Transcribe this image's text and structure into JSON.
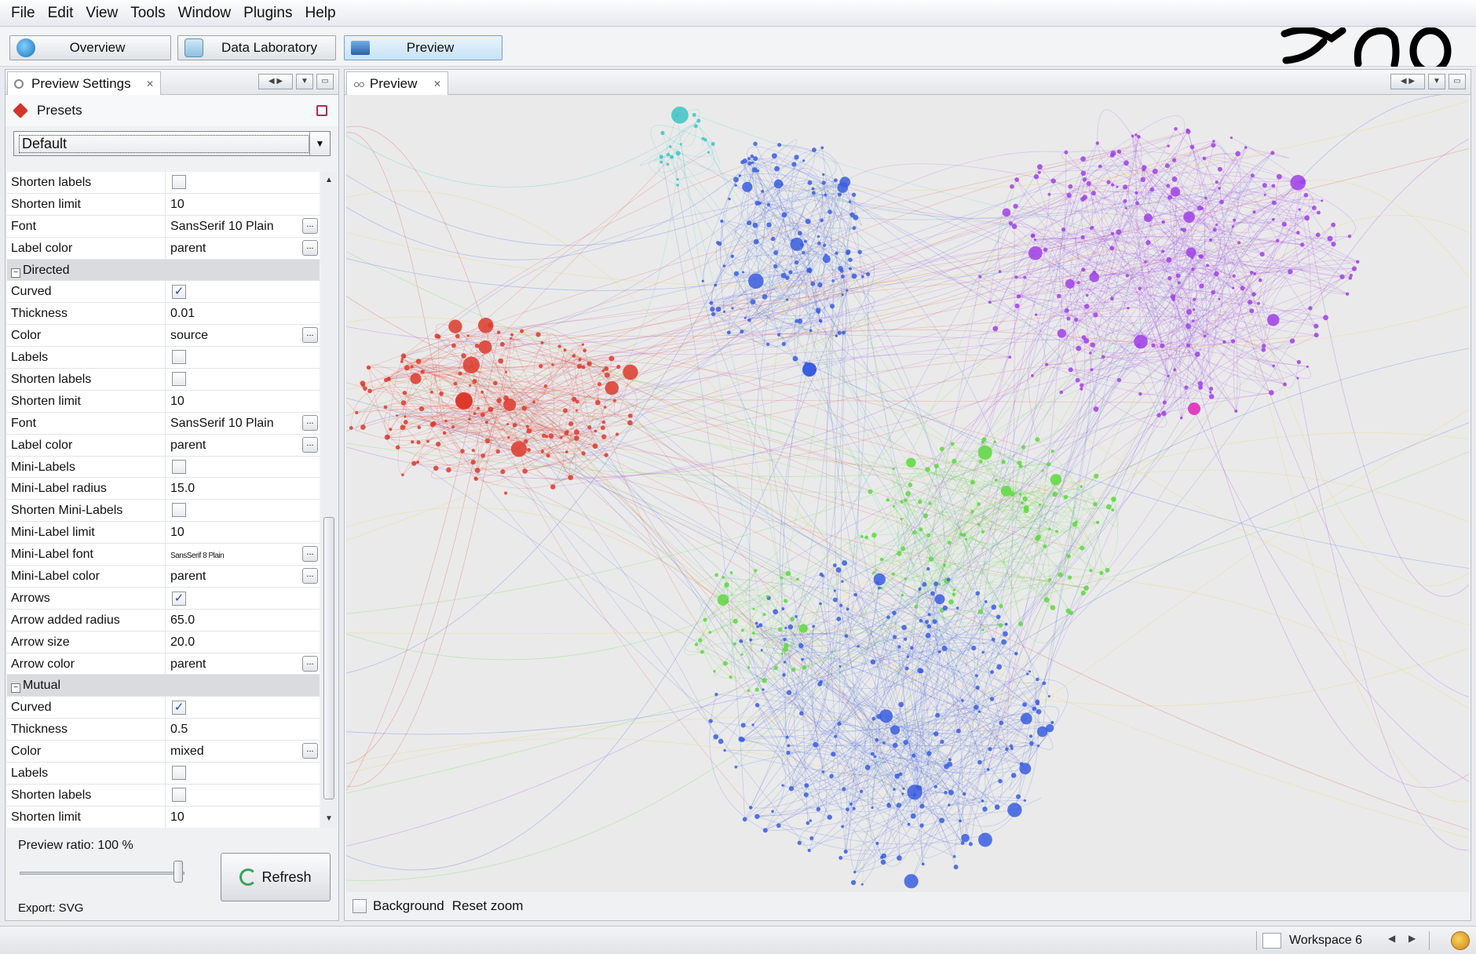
{
  "menu": [
    "File",
    "Edit",
    "View",
    "Tools",
    "Window",
    "Plugins",
    "Help"
  ],
  "toolbar": {
    "overview": "Overview",
    "data_lab": "Data Laboratory",
    "preview": "Preview"
  },
  "left_panel": {
    "tab_title": "Preview Settings",
    "presets_label": "Presets",
    "preset_value": "Default",
    "properties": [
      {
        "name": "Shorten labels",
        "type": "check",
        "checked": false
      },
      {
        "name": "Shorten limit",
        "type": "text",
        "value": "10"
      },
      {
        "name": "Font",
        "type": "text",
        "value": "SansSerif 10 Plain",
        "ellipsis": true
      },
      {
        "name": "Label color",
        "type": "text",
        "value": "parent",
        "ellipsis": true
      },
      {
        "name": "Directed",
        "type": "category"
      },
      {
        "name": "Curved",
        "type": "check",
        "checked": true
      },
      {
        "name": "Thickness",
        "type": "text",
        "value": "0.01"
      },
      {
        "name": "Color",
        "type": "text",
        "value": "source",
        "ellipsis": true
      },
      {
        "name": "Labels",
        "type": "check",
        "checked": false
      },
      {
        "name": "Shorten labels",
        "type": "check",
        "checked": false
      },
      {
        "name": "Shorten limit",
        "type": "text",
        "value": "10"
      },
      {
        "name": "Font",
        "type": "text",
        "value": "SansSerif 10 Plain",
        "ellipsis": true
      },
      {
        "name": "Label color",
        "type": "text",
        "value": "parent",
        "ellipsis": true
      },
      {
        "name": "Mini-Labels",
        "type": "check",
        "checked": false
      },
      {
        "name": "Mini-Label radius",
        "type": "text",
        "value": "15.0"
      },
      {
        "name": "Shorten Mini-Labels",
        "type": "check",
        "checked": false
      },
      {
        "name": "Mini-Label limit",
        "type": "text",
        "value": "10"
      },
      {
        "name": "Mini-Label font",
        "type": "text",
        "value": "SansSerif 8 Plain",
        "ellipsis": true,
        "tiny": true
      },
      {
        "name": "Mini-Label color",
        "type": "text",
        "value": "parent",
        "ellipsis": true
      },
      {
        "name": "Arrows",
        "type": "check",
        "checked": true
      },
      {
        "name": "Arrow added radius",
        "type": "text",
        "value": "65.0"
      },
      {
        "name": "Arrow size",
        "type": "text",
        "value": "20.0"
      },
      {
        "name": "Arrow color",
        "type": "text",
        "value": "parent",
        "ellipsis": true
      },
      {
        "name": "Mutual",
        "type": "category"
      },
      {
        "name": "Curved",
        "type": "check",
        "checked": true
      },
      {
        "name": "Thickness",
        "type": "text",
        "value": "0.5"
      },
      {
        "name": "Color",
        "type": "text",
        "value": "mixed",
        "ellipsis": true
      },
      {
        "name": "Labels",
        "type": "check",
        "checked": false
      },
      {
        "name": "Shorten labels",
        "type": "check",
        "checked": false
      },
      {
        "name": "Shorten limit",
        "type": "text",
        "value": "10"
      }
    ],
    "preview_ratio": "Preview ratio:  100 %",
    "refresh_label": "Refresh",
    "export_label": "Export:    SVG"
  },
  "right_panel": {
    "tab_title": "Preview",
    "background_label": "Background",
    "reset_zoom_label": "Reset zoom"
  },
  "statusbar": {
    "workspace": "Workspace 6"
  },
  "colors": {
    "red_cluster": "#dd3a2c",
    "purple_cluster": "#a040e8",
    "blue_cluster": "#3a5ee0",
    "green_cluster": "#5ed840",
    "teal": "#3cc4c4",
    "yellow": "#e8d040",
    "magenta": "#e040c0"
  },
  "icons": {
    "overview": "globe-icon",
    "data_lab": "table-icon",
    "preview": "monitor-icon",
    "presets": "pin-icon",
    "save": "save-icon",
    "refresh": "refresh-icon"
  }
}
